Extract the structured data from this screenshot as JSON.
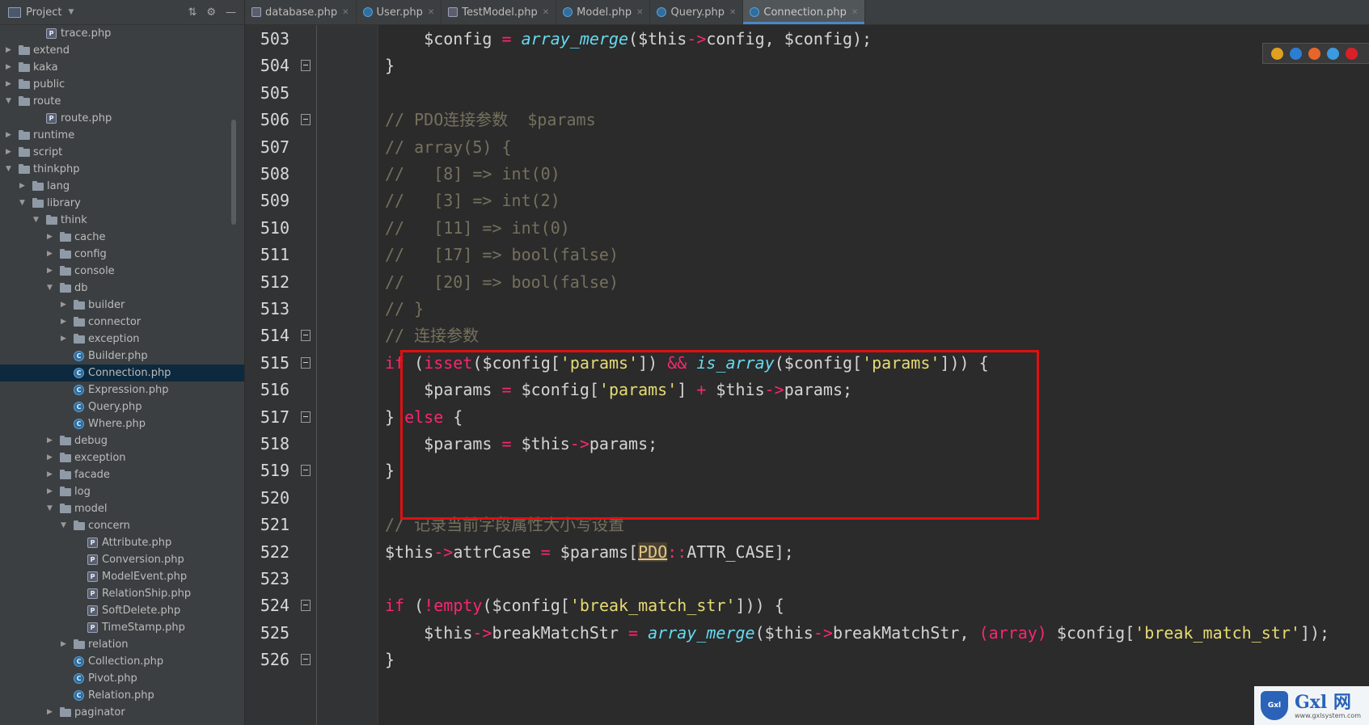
{
  "sidebar": {
    "title": "Project",
    "items": [
      {
        "label": "trace.php",
        "type": "php",
        "depth": 3,
        "arrow": ""
      },
      {
        "label": "extend",
        "type": "folder",
        "depth": 1,
        "arrow": "right"
      },
      {
        "label": "kaka",
        "type": "folder",
        "depth": 1,
        "arrow": "right"
      },
      {
        "label": "public",
        "type": "folder",
        "depth": 1,
        "arrow": "right"
      },
      {
        "label": "route",
        "type": "folder",
        "depth": 1,
        "arrow": "down"
      },
      {
        "label": "route.php",
        "type": "php",
        "depth": 3,
        "arrow": ""
      },
      {
        "label": "runtime",
        "type": "folder",
        "depth": 1,
        "arrow": "right"
      },
      {
        "label": "script",
        "type": "folder",
        "depth": 1,
        "arrow": "right"
      },
      {
        "label": "thinkphp",
        "type": "folder",
        "depth": 1,
        "arrow": "down"
      },
      {
        "label": "lang",
        "type": "folder",
        "depth": 2,
        "arrow": "right"
      },
      {
        "label": "library",
        "type": "folder",
        "depth": 2,
        "arrow": "down"
      },
      {
        "label": "think",
        "type": "folder",
        "depth": 3,
        "arrow": "down"
      },
      {
        "label": "cache",
        "type": "folder",
        "depth": 4,
        "arrow": "right"
      },
      {
        "label": "config",
        "type": "folder",
        "depth": 4,
        "arrow": "right"
      },
      {
        "label": "console",
        "type": "folder",
        "depth": 4,
        "arrow": "right"
      },
      {
        "label": "db",
        "type": "folder",
        "depth": 4,
        "arrow": "down"
      },
      {
        "label": "builder",
        "type": "folder",
        "depth": 5,
        "arrow": "right"
      },
      {
        "label": "connector",
        "type": "folder",
        "depth": 5,
        "arrow": "right"
      },
      {
        "label": "exception",
        "type": "folder",
        "depth": 5,
        "arrow": "right"
      },
      {
        "label": "Builder.php",
        "type": "class",
        "depth": 5,
        "arrow": ""
      },
      {
        "label": "Connection.php",
        "type": "class",
        "depth": 5,
        "arrow": "",
        "selected": true
      },
      {
        "label": "Expression.php",
        "type": "class",
        "depth": 5,
        "arrow": ""
      },
      {
        "label": "Query.php",
        "type": "class",
        "depth": 5,
        "arrow": ""
      },
      {
        "label": "Where.php",
        "type": "class",
        "depth": 5,
        "arrow": ""
      },
      {
        "label": "debug",
        "type": "folder",
        "depth": 4,
        "arrow": "right"
      },
      {
        "label": "exception",
        "type": "folder",
        "depth": 4,
        "arrow": "right"
      },
      {
        "label": "facade",
        "type": "folder",
        "depth": 4,
        "arrow": "right"
      },
      {
        "label": "log",
        "type": "folder",
        "depth": 4,
        "arrow": "right"
      },
      {
        "label": "model",
        "type": "folder",
        "depth": 4,
        "arrow": "down"
      },
      {
        "label": "concern",
        "type": "folder",
        "depth": 5,
        "arrow": "down"
      },
      {
        "label": "Attribute.php",
        "type": "php",
        "depth": 6,
        "arrow": ""
      },
      {
        "label": "Conversion.php",
        "type": "php",
        "depth": 6,
        "arrow": ""
      },
      {
        "label": "ModelEvent.php",
        "type": "php",
        "depth": 6,
        "arrow": ""
      },
      {
        "label": "RelationShip.php",
        "type": "php",
        "depth": 6,
        "arrow": ""
      },
      {
        "label": "SoftDelete.php",
        "type": "php",
        "depth": 6,
        "arrow": ""
      },
      {
        "label": "TimeStamp.php",
        "type": "php",
        "depth": 6,
        "arrow": ""
      },
      {
        "label": "relation",
        "type": "folder",
        "depth": 5,
        "arrow": "right"
      },
      {
        "label": "Collection.php",
        "type": "class",
        "depth": 5,
        "arrow": ""
      },
      {
        "label": "Pivot.php",
        "type": "class",
        "depth": 5,
        "arrow": ""
      },
      {
        "label": "Relation.php",
        "type": "class",
        "depth": 5,
        "arrow": ""
      },
      {
        "label": "paginator",
        "type": "folder",
        "depth": 4,
        "arrow": "right"
      }
    ]
  },
  "tabs": [
    {
      "label": "database.php",
      "type": "php",
      "active": false
    },
    {
      "label": "User.php",
      "type": "class",
      "active": false
    },
    {
      "label": "TestModel.php",
      "type": "php",
      "active": false
    },
    {
      "label": "Model.php",
      "type": "class",
      "active": false
    },
    {
      "label": "Query.php",
      "type": "class",
      "active": false
    },
    {
      "label": "Connection.php",
      "type": "class",
      "active": true
    }
  ],
  "editor": {
    "lines": [
      {
        "n": "503",
        "fold": false,
        "html": "    $config <span class=\"op\">=</span> <span class=\"fn\">array_merge</span>($this<span class=\"op\">-&gt;</span>config, $config);"
      },
      {
        "n": "504",
        "fold": true,
        "html": "}"
      },
      {
        "n": "505",
        "fold": false,
        "html": ""
      },
      {
        "n": "506",
        "fold": true,
        "html": "<span class=\"cm\">// PDO连接参数  $params</span>"
      },
      {
        "n": "507",
        "fold": false,
        "html": "<span class=\"cm\">// array(5) {</span>"
      },
      {
        "n": "508",
        "fold": false,
        "html": "<span class=\"cm\">//   [8] =&gt; int(0)</span>"
      },
      {
        "n": "509",
        "fold": false,
        "html": "<span class=\"cm\">//   [3] =&gt; int(2)</span>"
      },
      {
        "n": "510",
        "fold": false,
        "html": "<span class=\"cm\">//   [11] =&gt; int(0)</span>"
      },
      {
        "n": "511",
        "fold": false,
        "html": "<span class=\"cm\">//   [17] =&gt; bool(false)</span>"
      },
      {
        "n": "512",
        "fold": false,
        "html": "<span class=\"cm\">//   [20] =&gt; bool(false)</span>"
      },
      {
        "n": "513",
        "fold": false,
        "html": "<span class=\"cm\">// }</span>"
      },
      {
        "n": "514",
        "fold": true,
        "html": "<span class=\"cm\">// 连接参数</span>"
      },
      {
        "n": "515",
        "fold": true,
        "html": "<span class=\"kw\">if</span> (<span class=\"kw\">isset</span>($config[<span class=\"str\">'params'</span>]) <span class=\"op\">&amp;&amp;</span> <span class=\"fn\">is_array</span>($config[<span class=\"str\">'params'</span>])) {"
      },
      {
        "n": "516",
        "fold": false,
        "html": "    $params <span class=\"op\">=</span> $config[<span class=\"str\">'params'</span>] <span class=\"op\">+</span> $this<span class=\"op\">-&gt;</span>params;"
      },
      {
        "n": "517",
        "fold": true,
        "html": "} <span class=\"kw\">else</span> {"
      },
      {
        "n": "518",
        "fold": false,
        "html": "    $params <span class=\"op\">=</span> $this<span class=\"op\">-&gt;</span>params;"
      },
      {
        "n": "519",
        "fold": true,
        "html": "}"
      },
      {
        "n": "520",
        "fold": false,
        "html": ""
      },
      {
        "n": "521",
        "fold": false,
        "html": "<span class=\"cm\">// 记录当前字段属性大小写设置</span>"
      },
      {
        "n": "522",
        "fold": false,
        "html": "$this<span class=\"op\">-&gt;</span>attrCase <span class=\"op\">=</span> $params[<span class=\"pdo\">PDO</span><span class=\"op\">::</span>ATTR_CASE];"
      },
      {
        "n": "523",
        "fold": false,
        "html": ""
      },
      {
        "n": "524",
        "fold": true,
        "html": "<span class=\"kw\">if</span> (<span class=\"op\">!</span><span class=\"kw\">empty</span>($config[<span class=\"str\">'break_match_str'</span>])) {"
      },
      {
        "n": "525",
        "fold": false,
        "html": "    $this<span class=\"op\">-&gt;</span>breakMatchStr <span class=\"op\">=</span> <span class=\"fn\">array_merge</span>($this<span class=\"op\">-&gt;</span>breakMatchStr, <span class=\"cast\">(array)</span> $config[<span class=\"str\">'break_match_str'</span>]);"
      },
      {
        "n": "526",
        "fold": true,
        "html": "}"
      }
    ]
  },
  "browser_icons": [
    {
      "name": "chrome-icon",
      "color": "#e0a020"
    },
    {
      "name": "edge-icon",
      "color": "#2d7dd2"
    },
    {
      "name": "firefox-icon",
      "color": "#e8652a"
    },
    {
      "name": "safari-icon",
      "color": "#3a9be0"
    },
    {
      "name": "opera-icon",
      "color": "#d8202a"
    }
  ],
  "watermark": {
    "badge": "Gxl",
    "main": "Gxl 网",
    "sub": "www.gxlsystem.com"
  }
}
